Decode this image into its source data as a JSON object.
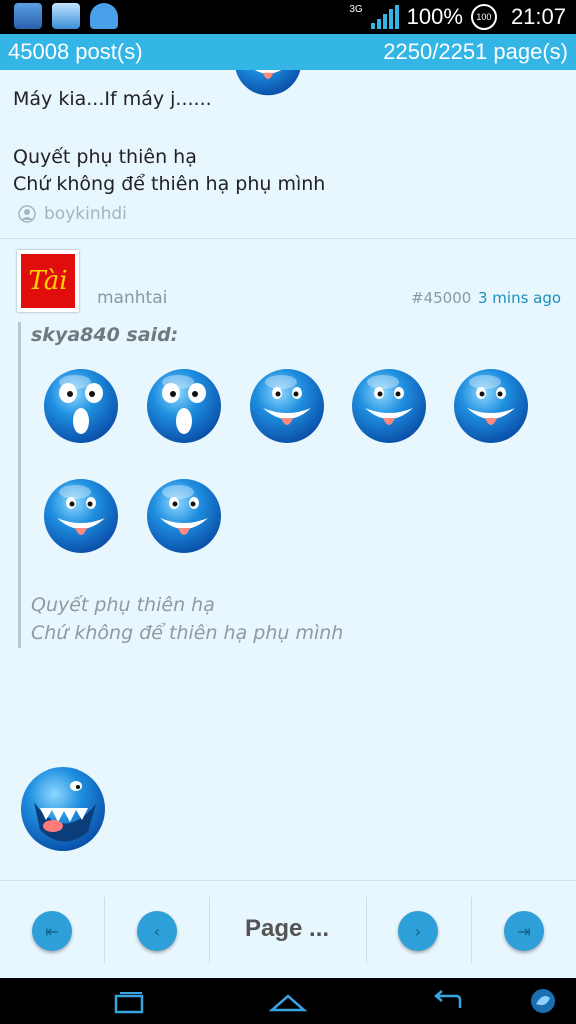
{
  "status": {
    "network": "3G",
    "battery": "100%",
    "battery_badge": "100",
    "time": "21:07"
  },
  "header": {
    "posts": "45008 post(s)",
    "pages": "2250/2251 page(s)"
  },
  "prev_post": {
    "line1": "Máy kia...If máy j......",
    "line2": "Quyết phụ thiên hạ",
    "line3": "Chứ không để thiên hạ phụ mình",
    "author": "boykinhdi"
  },
  "post": {
    "avatar_text": "Tài",
    "username": "manhtai",
    "number": "#45000",
    "time": "3 mins ago",
    "quote": {
      "said": "skya840 said:",
      "line1": "Quyết phụ thiên hạ",
      "line2": "Chứ không để thiên hạ phụ mình"
    }
  },
  "pager": {
    "label": "Page ...",
    "first_icon": "first-page-icon",
    "prev_icon": "prev-page-icon",
    "next_icon": "next-page-icon",
    "last_icon": "last-page-icon"
  },
  "colors": {
    "accent": "#33b5e5",
    "background": "#e8f6fd",
    "link": "#1b8fbf"
  }
}
